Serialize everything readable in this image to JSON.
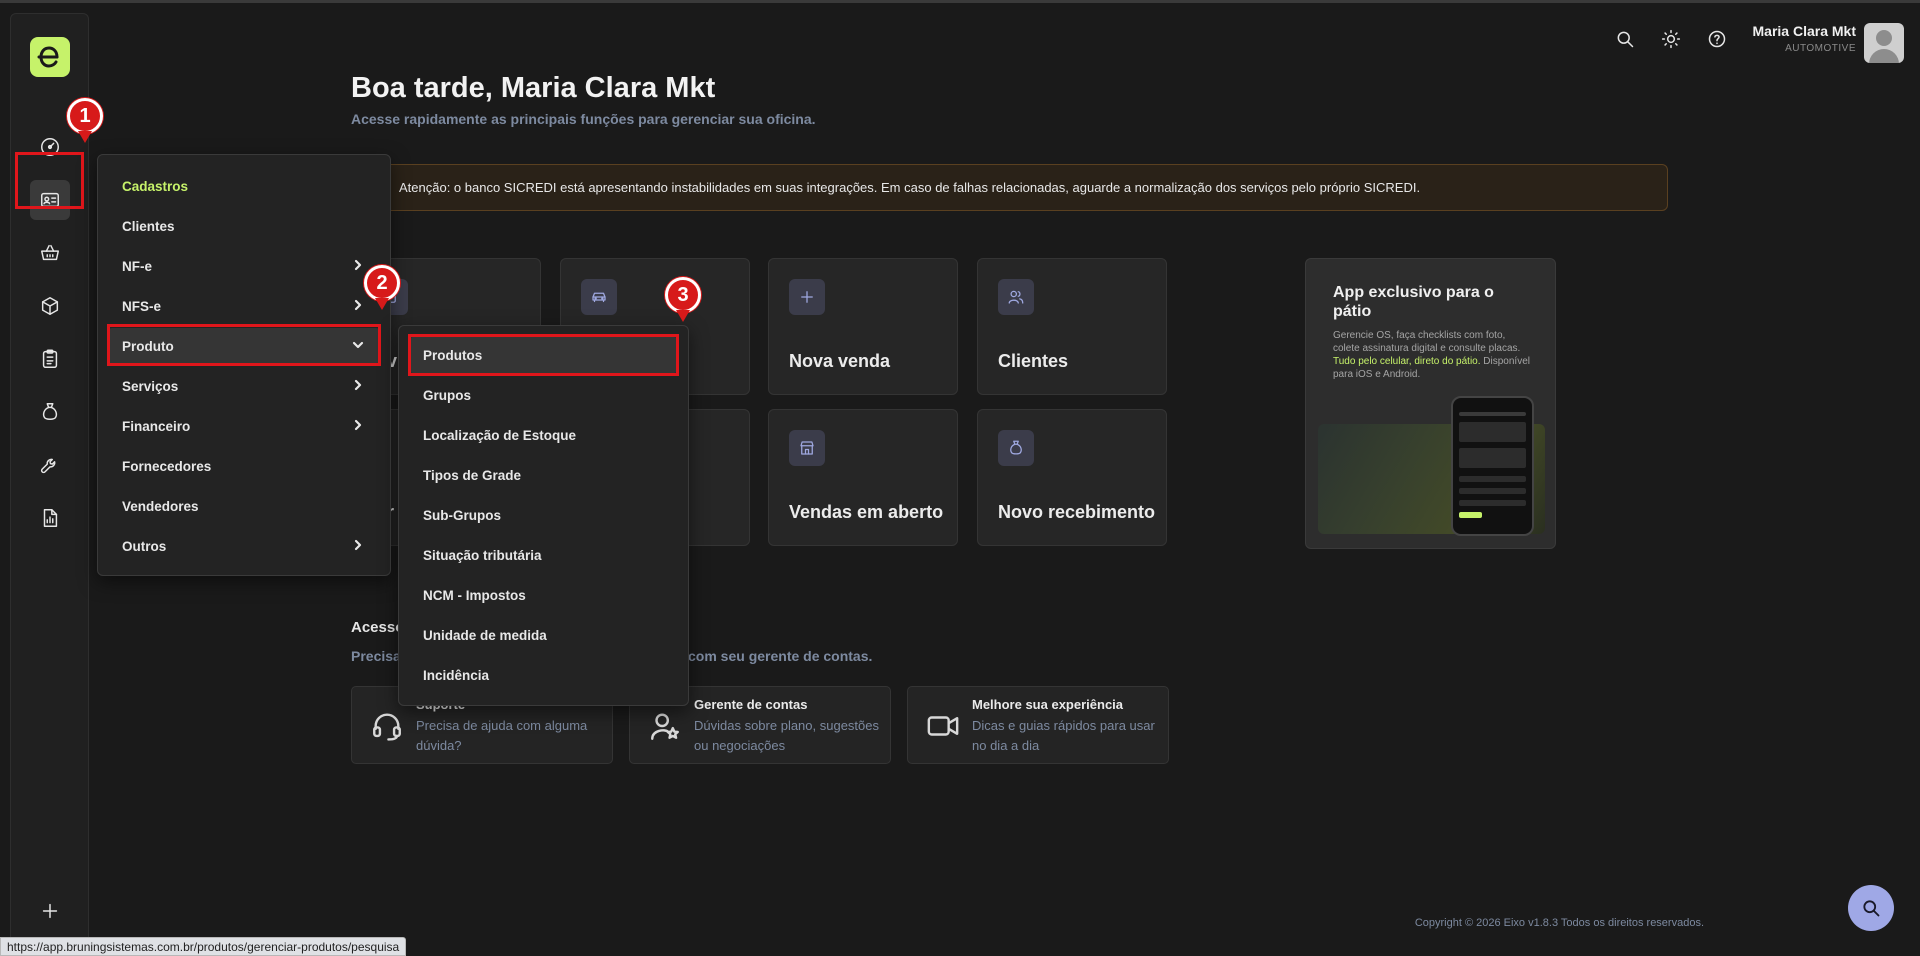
{
  "header": {
    "user_name": "Maria Clara Mkt",
    "user_company": "AUTOMOTIVE",
    "icons": [
      "search-icon",
      "sun-icon",
      "help-icon"
    ]
  },
  "greeting": {
    "title": "Boa tarde, Maria Clara Mkt",
    "subtitle": "Acesse rapidamente as principais funções para gerenciar sua oficina."
  },
  "alert": {
    "text": "Atenção: o banco SICREDI está apresentando instabilidades em suas integrações. Em caso de falhas relacionadas, aguarde a normalização dos serviços pelo próprio SICREDI."
  },
  "sidebar": {
    "items": [
      "dashboard-icon",
      "cadastros-icon",
      "basket-icon",
      "box-icon",
      "clipboard-icon",
      "money-bag-icon",
      "wrench-icon",
      "report-icon"
    ],
    "add_label": "+"
  },
  "cards": {
    "nova_venda": "Nova venda",
    "clientes": "Clientes",
    "vendas_aberto": "Vendas em aberto",
    "novo_recebimento": "Novo recebimento",
    "partial_a": "v",
    "partial_b": "r"
  },
  "app_card": {
    "title": "App exclusivo para o pátio",
    "desc_start": "Gerencie OS, faça checklists com foto, colete assinatura digital e consulte placas. ",
    "desc_highlight": "Tudo pelo celular, direto do pátio.",
    "desc_end": " Disponível para iOS e Android."
  },
  "access": {
    "title": "Acesso",
    "subtitle_start": "Precisa",
    "subtitle_end": "com seu gerente de contas."
  },
  "help_cards": [
    {
      "title": "Suporte",
      "desc": "Precisa de ajuda com alguma dúvida?"
    },
    {
      "title": "Gerente de contas",
      "desc": "Dúvidas sobre plano, sugestões ou negociações"
    },
    {
      "title": "Melhore sua experiência",
      "desc": "Dicas e guias rápidos para usar no dia a dia"
    }
  ],
  "menu": {
    "header": "Cadastros",
    "items": [
      "Clientes",
      "NF-e",
      "NFS-e",
      "Produto",
      "Serviços",
      "Financeiro",
      "Fornecedores",
      "Vendedores",
      "Outros"
    ]
  },
  "submenu": {
    "items": [
      "Produtos",
      "Grupos",
      "Localização de Estoque",
      "Tipos de Grade",
      "Sub-Grupos",
      "Situação tributária",
      "NCM - Impostos",
      "Unidade de medida",
      "Incidência"
    ]
  },
  "markers": [
    "1",
    "2",
    "3"
  ],
  "footer": {
    "copyright": "Copyright © 2026 Eixo v1.8.3 Todos os direitos reservados.",
    "status_url": "https://app.bruningsistemas.com.br/produtos/gerenciar-produtos/pesquisa"
  },
  "colors": {
    "accent": "#c6f26a",
    "highlight": "#e0161b",
    "icon_tile": "#3b3c4a",
    "muted_text": "#7d8aa0"
  }
}
